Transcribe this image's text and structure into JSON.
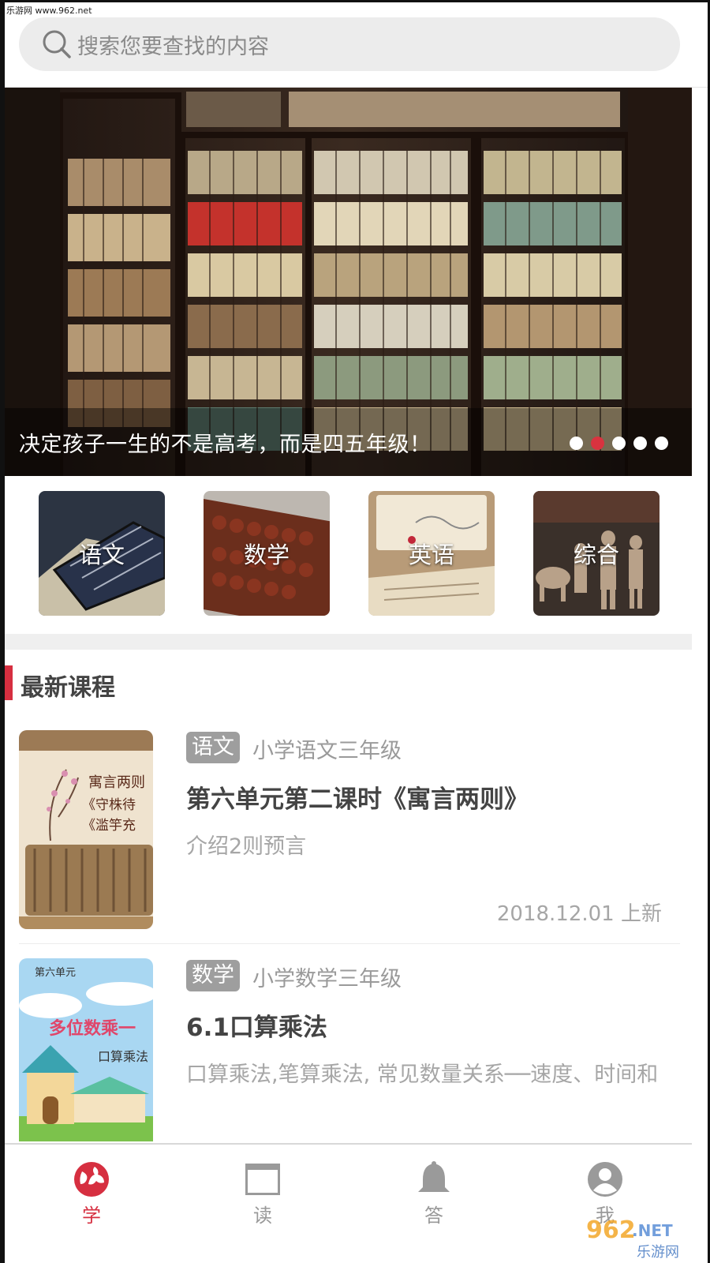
{
  "watermark": "乐游网 www.962.net",
  "search": {
    "placeholder": "搜索您要查找的内容"
  },
  "banner": {
    "caption": "决定孩子一生的不是高考，而是四五年级！",
    "slides": 5,
    "active_slide": 2
  },
  "categories": [
    {
      "label": "语文",
      "icon": "chinese-category-image"
    },
    {
      "label": "数学",
      "icon": "abacus-category-image"
    },
    {
      "label": "英语",
      "icon": "english-category-image"
    },
    {
      "label": "综合",
      "icon": "general-category-image"
    }
  ],
  "section": {
    "title": "最新课程"
  },
  "courses": [
    {
      "tag": "语文",
      "grade": "小学语文三年级",
      "title": "第六单元第二课时《寓言两则》",
      "desc": "介绍2则预言",
      "date": "2018.12.01 上新",
      "thumb_lines": [
        "寓言两则",
        "《守株待",
        "《滥竽充"
      ]
    },
    {
      "tag": "数学",
      "grade": "小学数学三年级",
      "title": "6.1口算乘法",
      "desc": "口算乘法,笔算乘法, 常见数量关系──速度、时间和",
      "thumb_lines": [
        "第六单元",
        "多位数乘一",
        "口算乘法"
      ]
    }
  ],
  "nav": [
    {
      "label": "学",
      "icon": "globe-icon",
      "active": true
    },
    {
      "label": "读",
      "icon": "book-icon",
      "active": false
    },
    {
      "label": "答",
      "icon": "bell-icon",
      "active": false
    },
    {
      "label": "我",
      "icon": "user-icon",
      "active": false
    }
  ],
  "colors": {
    "accent": "#d62f40",
    "tag_bg": "#9e9e9e",
    "search_bg": "#ececec"
  },
  "bottom_watermark": "962.NET 乐游网"
}
